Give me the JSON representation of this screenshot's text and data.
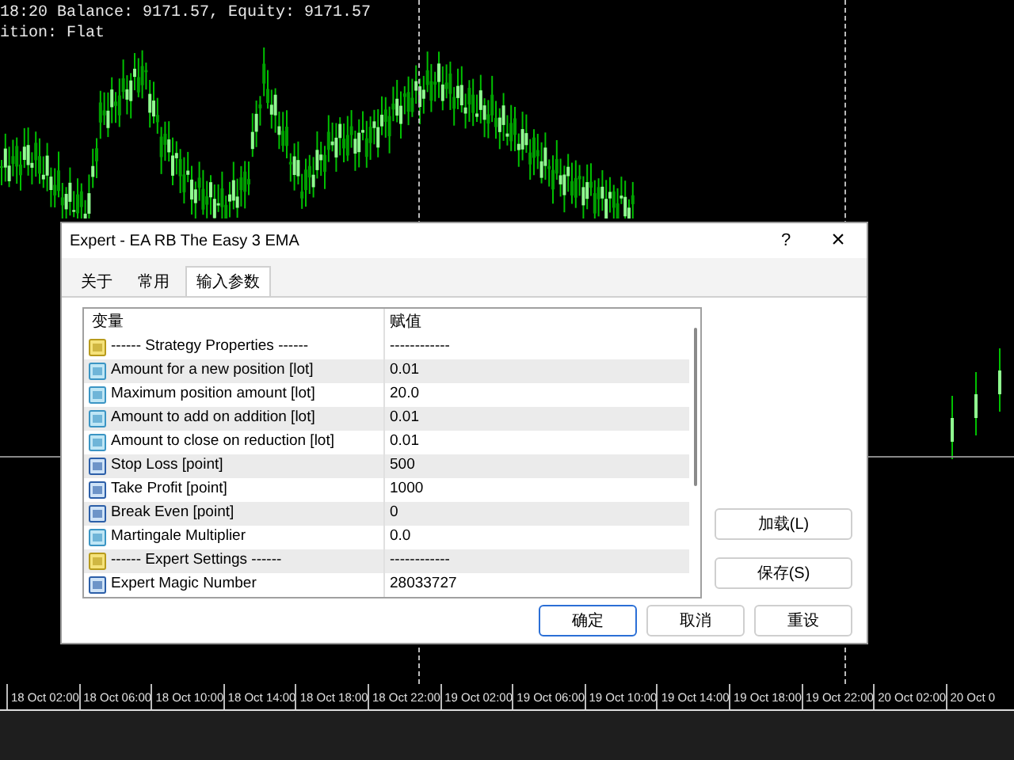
{
  "chart": {
    "info_lines": [
      "18:20 Balance: 9171.57, Equity: 9171.57",
      "ition: Flat"
    ],
    "time_axis": [
      "18 Oct 02:00",
      "18 Oct 06:00",
      "18 Oct 10:00",
      "18 Oct 14:00",
      "18 Oct 18:00",
      "18 Oct 22:00",
      "19 Oct 02:00",
      "19 Oct 06:00",
      "19 Oct 10:00",
      "19 Oct 14:00",
      "19 Oct 18:00",
      "19 Oct 22:00",
      "20 Oct 02:00",
      "20 Oct 0"
    ]
  },
  "dialog": {
    "title": "Expert - EA RB The Easy 3 EMA",
    "help": "?",
    "close": "×",
    "tabs": [
      {
        "label": "关于",
        "selected": false
      },
      {
        "label": "常用",
        "selected": false
      },
      {
        "label": "输入参数",
        "selected": true
      }
    ],
    "table": {
      "columns": [
        "变量",
        "赋值"
      ],
      "rows": [
        {
          "kind": "string",
          "name": "------ Strategy Properties ------",
          "value": "------------"
        },
        {
          "kind": "double",
          "name": "Amount for a new position [lot]",
          "value": "0.01"
        },
        {
          "kind": "double",
          "name": "Maximum position amount [lot]",
          "value": "20.0"
        },
        {
          "kind": "double",
          "name": "Amount to add on addition [lot]",
          "value": "0.01"
        },
        {
          "kind": "double",
          "name": "Amount to close on reduction [lot]",
          "value": "0.01"
        },
        {
          "kind": "int",
          "name": "Stop Loss [point]",
          "value": "500"
        },
        {
          "kind": "int",
          "name": "Take Profit [point]",
          "value": "1000"
        },
        {
          "kind": "int",
          "name": "Break Even [point]",
          "value": "0"
        },
        {
          "kind": "double",
          "name": "Martingale Multiplier",
          "value": "0.0"
        },
        {
          "kind": "string",
          "name": "------ Expert Settings ------",
          "value": "------------"
        },
        {
          "kind": "int",
          "name": "Expert Magic Number",
          "value": "28033727"
        }
      ]
    },
    "side_buttons": [
      "加载(L)",
      "保存(S)"
    ],
    "buttons": [
      {
        "label": "确定",
        "default": true
      },
      {
        "label": "取消",
        "default": false
      },
      {
        "label": "重设",
        "default": false
      }
    ]
  }
}
